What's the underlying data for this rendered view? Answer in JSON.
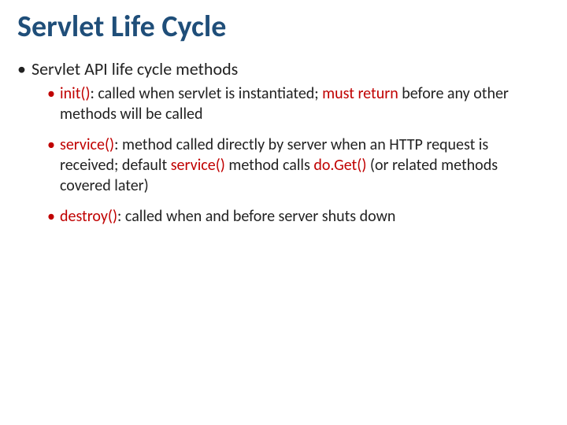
{
  "title": "Servlet Life Cycle",
  "top_bullet": "Servlet API life cycle methods",
  "items": [
    {
      "method": "init()",
      "sep": ": ",
      "t1": "called when servlet is instantiated; ",
      "emph": "must return",
      "t2": " before any other methods will be called"
    },
    {
      "method": "service()",
      "sep": ": ",
      "t1": "method called directly by server when an HTTP request is received; default ",
      "inline_method1": "service()",
      "t2": " method calls ",
      "inline_method2": "do.Get()",
      "t3": " (or related methods covered later)"
    },
    {
      "method": "destroy()",
      "sep": ": ",
      "t1": "called when and before server shuts down"
    }
  ]
}
